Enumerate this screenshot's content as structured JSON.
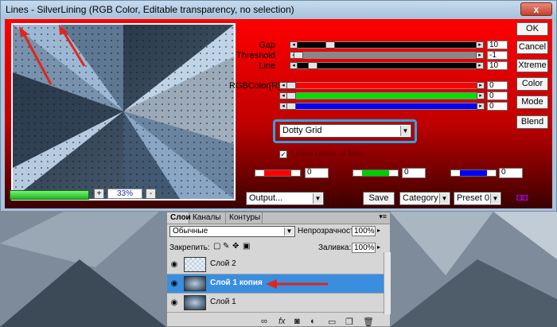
{
  "window": {
    "title": "Lines - SilverLining (RGB Color, Editable transparency, no selection)",
    "close_label": "x"
  },
  "preview": {
    "zoom": "33%",
    "zoom_plus": "+",
    "zoom_minus": "-",
    "progress": 1.0
  },
  "controls": {
    "gap": {
      "label": "Gap",
      "value": "10"
    },
    "threshold": {
      "label": "Threshold",
      "value": "-1"
    },
    "line": {
      "label": "Line",
      "value": "10"
    },
    "rgb_label": "RGBColor[R]",
    "red_value": "0",
    "green_value": "0",
    "blue_value": "0",
    "pattern_selected": "Dotty Grid",
    "checkbox_label": "Leave center of lines",
    "checkbox_checked": true,
    "mini1_value": "0",
    "mini2_value": "0",
    "mini3_value": "0"
  },
  "buttons": {
    "ok": "OK",
    "cancel": "Cancel",
    "xtreme": "Xtreme",
    "color": "Color",
    "mode": "Mode",
    "blend": "Blend",
    "save": "Save"
  },
  "bottom": {
    "output": "Output...",
    "category": "Category",
    "preset": "Preset 0",
    "logo_text": "◘◘"
  },
  "layers_panel": {
    "tabs": [
      "Слои",
      "Каналы",
      "Контуры"
    ],
    "blend_mode": "Обычные",
    "opacity_label": "Непрозрачность:",
    "opacity_value": "100%",
    "lock_label": "Закрепить:",
    "fill_label": "Заливка:",
    "fill_value": "100%",
    "layers": [
      {
        "name": "Слой 2",
        "selected": false
      },
      {
        "name": "Слой 1 копия",
        "selected": true
      },
      {
        "name": "Слой 1",
        "selected": false
      }
    ],
    "footer_icons": [
      "link-icon",
      "fx-icon",
      "mask-icon",
      "adjustment-icon",
      "folder-icon",
      "new-layer-icon",
      "trash-icon"
    ]
  },
  "colors": {
    "accent_blue": "#2fa4e0",
    "selection_blue": "#3a8ee0",
    "annotation_red": "#e0261b"
  }
}
